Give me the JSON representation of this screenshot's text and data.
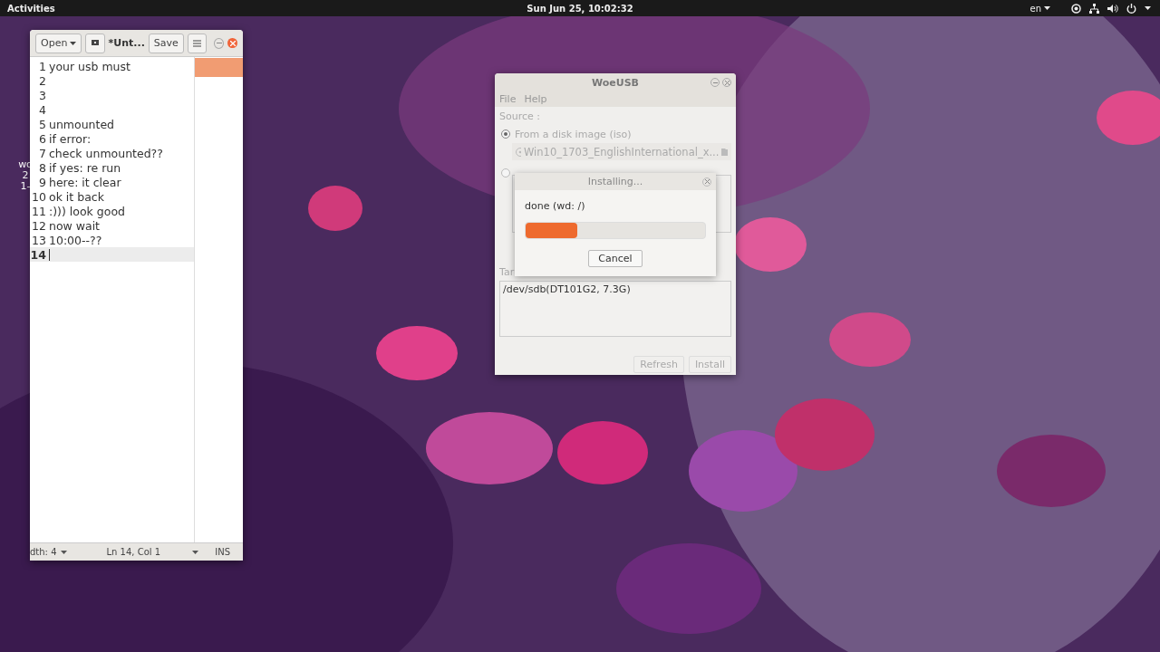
{
  "top_bar": {
    "activities": "Activities",
    "clock": "Sun Jun 25, 10:02:32",
    "language": "en"
  },
  "desktop_icon": {
    "lines": [
      "wo",
      "2",
      "1-"
    ]
  },
  "editor": {
    "open_button": "Open",
    "title": "*Unt...",
    "save_button": "Save",
    "lines": [
      {
        "number": "1",
        "text": "your usb must",
        "current": false
      },
      {
        "number": "2",
        "current": false
      },
      {
        "number": "3",
        "current": false
      },
      {
        "number": "4",
        "current": false
      },
      {
        "number": "5",
        "text": "unmounted",
        "current": false
      },
      {
        "number": "6",
        "text": "if error:",
        "current": false
      },
      {
        "number": "7",
        "text": "check unmounted??",
        "current": false
      },
      {
        "number": "8",
        "text": "if yes: re run",
        "current": false
      },
      {
        "number": "9",
        "text": "here: it clear",
        "current": false
      },
      {
        "number": "10",
        "text": "ok it back",
        "current": false
      },
      {
        "number": "11",
        "text": ":))) look good",
        "current": false
      },
      {
        "number": "12",
        "text": "now wait",
        "current": false
      },
      {
        "number": "13",
        "text": "10:00--??",
        "current": false
      },
      {
        "number": "14",
        "current": true
      }
    ],
    "status_bar": {
      "tab_width": "dth: 4",
      "position": "Ln 14, Col 1",
      "mode": "INS"
    }
  },
  "woeusb": {
    "title": "WoeUSB",
    "menu": [
      "File",
      "Help"
    ],
    "disabled": true,
    "source_label": "Source :",
    "options": [
      {
        "label": "From a disk image (iso)",
        "selected": true
      },
      {
        "selected": false
      }
    ],
    "iso_file": "Win10_1703_EnglishInternational_x...",
    "target_label": "Tar",
    "devices": [
      "/dev/sdb(DT101G2,  7.3G)"
    ],
    "buttons": [
      "Refresh",
      "Install"
    ]
  },
  "dialog": {
    "title": "Installing...",
    "message": "done  (wd: /)",
    "level": 0.29,
    "cancel_button": "Cancel"
  }
}
